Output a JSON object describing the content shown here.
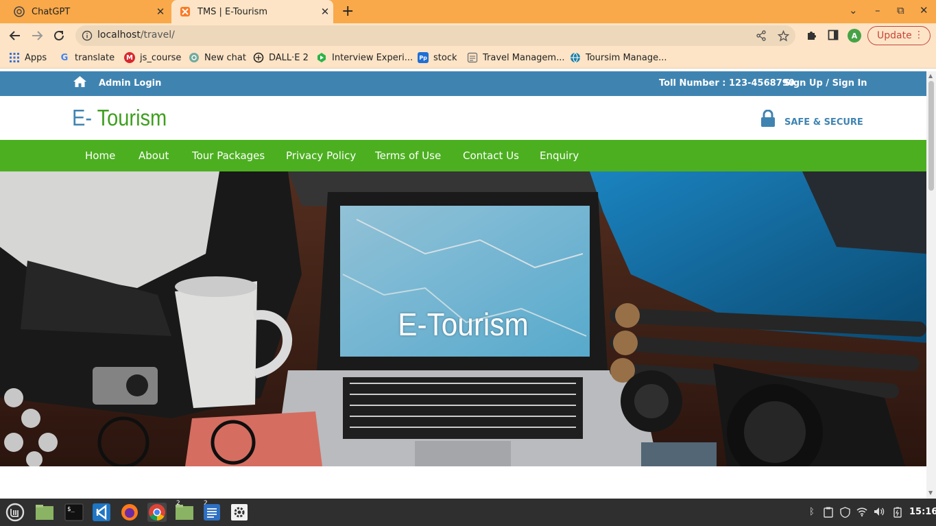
{
  "browser": {
    "tabs": [
      {
        "title": "ChatGPT",
        "favicon": "chatgpt-icon",
        "active": false
      },
      {
        "title": "TMS | E-Tourism",
        "favicon": "xampp-icon",
        "active": true
      }
    ],
    "url_host": "localhost",
    "url_path": "/travel/",
    "avatar_letter": "A",
    "update_label": "Update",
    "accent": "#f9a94a"
  },
  "bookmarks": [
    {
      "label": "Apps",
      "icon": "apps-grid-icon"
    },
    {
      "label": "translate",
      "icon": "google-icon"
    },
    {
      "label": "js_course",
      "icon": "mega-icon"
    },
    {
      "label": "New chat",
      "icon": "chatgpt-icon"
    },
    {
      "label": "DALL·E 2",
      "icon": "openai-icon"
    },
    {
      "label": "Interview Experi...",
      "icon": "leaf-icon"
    },
    {
      "label": "stock",
      "icon": "pp-icon"
    },
    {
      "label": "Travel Managem...",
      "icon": "page-icon"
    },
    {
      "label": "Toursim Manage...",
      "icon": "globe-icon"
    }
  ],
  "site": {
    "top": {
      "admin_login": "Admin Login",
      "toll": "Toll Number : 123-4568790",
      "signup": "Sign Up / Sign In",
      "bg": "#3f84b1"
    },
    "brand": {
      "prefix": "E-",
      "name": "Tourism"
    },
    "safe": "SAFE & SECURE",
    "nav": [
      "Home",
      "About",
      "Tour Packages",
      "Privacy Policy",
      "Terms of Use",
      "Contact Us",
      "Enquiry"
    ],
    "nav_bg": "#4caf20",
    "hero_title": "E-Tourism"
  },
  "taskbar": {
    "apps": [
      "mint-menu-icon",
      "files-icon",
      "terminal-icon",
      "vscode-icon",
      "firefox-icon",
      "chrome-icon",
      "files-icon",
      "text-editor-icon",
      "settings-icon"
    ],
    "badges": [
      "2",
      "2"
    ],
    "clock": "15:16"
  }
}
